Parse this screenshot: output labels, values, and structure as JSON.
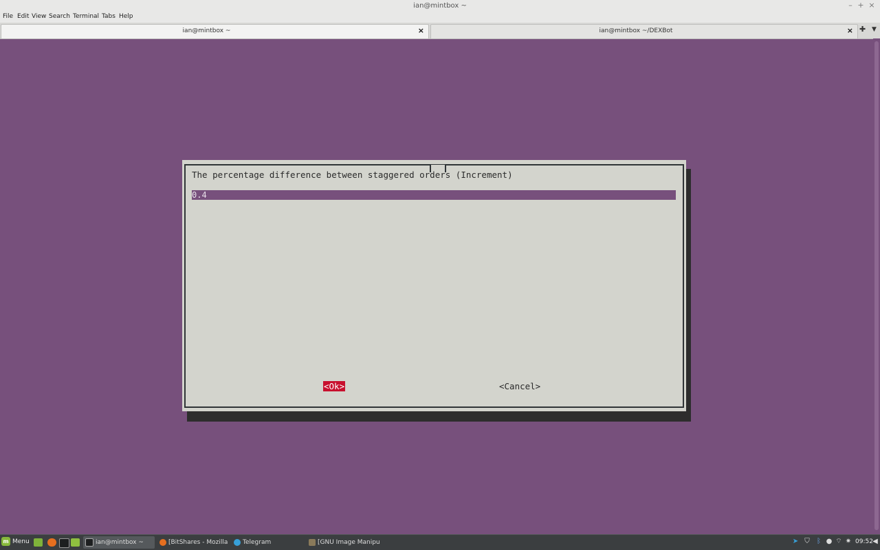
{
  "window": {
    "title": "ian@mintbox ~"
  },
  "menu": [
    "File",
    "Edit",
    "View",
    "Search",
    "Terminal",
    "Tabs",
    "Help"
  ],
  "tabs": [
    {
      "label": "ian@mintbox ~"
    },
    {
      "label": "ian@mintbox ~/DEXBot"
    }
  ],
  "dialog": {
    "prompt": "The percentage difference between staggered orders (Increment)",
    "input_value": "0.4",
    "ok_label": "<Ok>",
    "cancel_label": "<Cancel>"
  },
  "taskbar": {
    "menu_label": "Menu",
    "tasks": [
      {
        "label": "ian@mintbox ~"
      },
      {
        "label": "[BitShares - Mozilla ..."
      },
      {
        "label": "Telegram"
      },
      {
        "label": "[GNU Image Manipu..."
      }
    ],
    "clock": "09:52"
  },
  "colors": {
    "terminal_bg": "#77507c",
    "dialog_bg": "#d3d4cd",
    "ok_highlight": "#c8102e"
  }
}
